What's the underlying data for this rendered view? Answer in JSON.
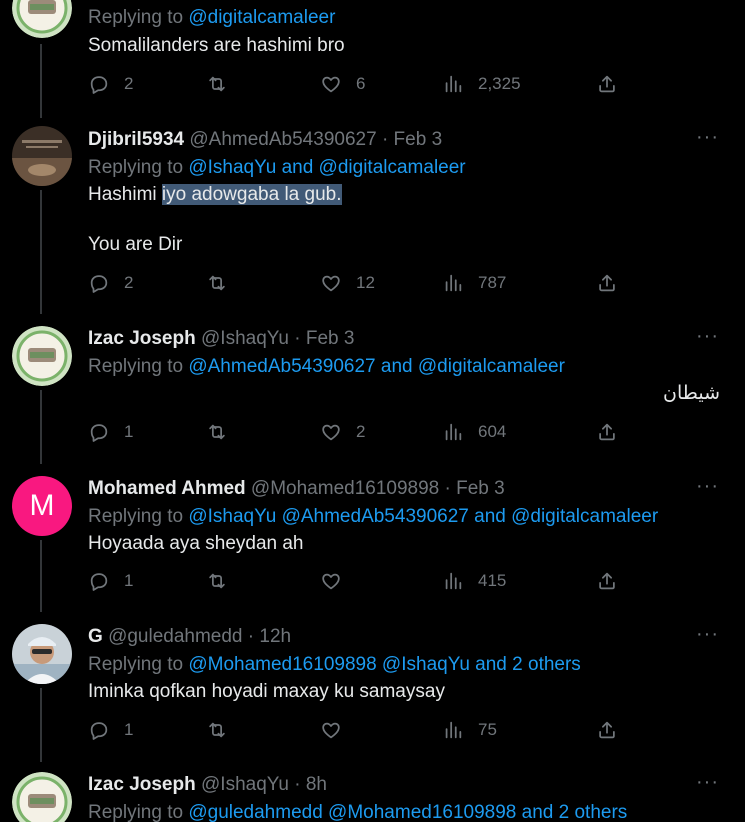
{
  "colors": {
    "link": "#1d9bf0",
    "muted": "#71767b",
    "text": "#e7e9ea",
    "highlight": "#415a77",
    "avatar_m": "#f91880"
  },
  "icons": {
    "reply": "speech-bubble-icon",
    "retweet": "retweet-icon",
    "like": "heart-icon",
    "views": "bar-chart-icon",
    "share": "share-icon",
    "more": "ellipsis-icon"
  },
  "tweets": [
    {
      "replying_prefix": "Replying to",
      "replying_to": "@digitalcamaleer",
      "text": "Somalilanders are hashimi bro",
      "replies": "2",
      "retweets": "",
      "likes": "6",
      "views": "2,325"
    },
    {
      "name": "Djibril5934",
      "handle": "@AhmedAb54390627",
      "sep": "·",
      "time": "Feb 3",
      "replying_prefix": "Replying to",
      "replying_to": "@IshaqYu and @digitalcamaleer",
      "text_pre": "Hashimi ",
      "text_hl": "iyo adowgaba la gub. ",
      "text_2": "You are Dir",
      "replies": "2",
      "retweets": "",
      "likes": "12",
      "views": "787"
    },
    {
      "name": "Izac Joseph",
      "handle": "@IshaqYu",
      "sep": "·",
      "time": "Feb 3",
      "replying_prefix": "Replying to",
      "replying_to": "@AhmedAb54390627 and @digitalcamaleer",
      "text": "شيطان",
      "replies": "1",
      "retweets": "",
      "likes": "2",
      "views": "604"
    },
    {
      "avatar_letter": "M",
      "name": "Mohamed Ahmed",
      "handle": "@Mohamed16109898",
      "sep": "·",
      "time": "Feb 3",
      "replying_prefix": "Replying to",
      "replying_to": "@IshaqYu @AhmedAb54390627 and @digitalcamaleer",
      "text": "Hoyaada aya sheydan ah",
      "replies": "1",
      "retweets": "",
      "likes": "",
      "views": "415"
    },
    {
      "name": "G",
      "handle": "@guledahmedd",
      "sep": "·",
      "time": "12h",
      "replying_prefix": "Replying to",
      "replying_to": "@Mohamed16109898 @IshaqYu and 2 others",
      "text": "Iminka qofkan hoyadi maxay ku samaysay",
      "replies": "1",
      "retweets": "",
      "likes": "",
      "views": "75"
    },
    {
      "name": "Izac Joseph",
      "handle": "@IshaqYu",
      "sep": "·",
      "time": "8h",
      "replying_prefix": "Replying to",
      "replying_to": "@guledahmedd @Mohamed16109898 and 2 others"
    }
  ]
}
